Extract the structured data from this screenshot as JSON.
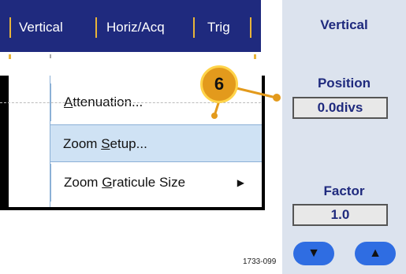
{
  "menubar": {
    "items": [
      {
        "label": "Vertical"
      },
      {
        "label": "Horiz/Acq"
      },
      {
        "label": "Trig"
      }
    ]
  },
  "dropdown": {
    "items": [
      {
        "label_prefix": "",
        "label_underline": "A",
        "label_suffix": "ttenuation..."
      },
      {
        "label_prefix": "Zoom ",
        "label_underline": "S",
        "label_suffix": "etup..."
      },
      {
        "label_prefix": "Zoom ",
        "label_underline": "G",
        "label_suffix": "raticule Size"
      }
    ],
    "submenu_arrow": "▶"
  },
  "callout": {
    "number": "6"
  },
  "panel": {
    "title": "Vertical",
    "position": {
      "label": "Position",
      "value": "0.0divs"
    },
    "factor": {
      "label": "Factor",
      "value": "1.0"
    },
    "down_arrow": "▼",
    "up_arrow": "▲"
  },
  "figure_id": "1733-099",
  "colors": {
    "menubar_bg": "#1f2a7e",
    "separator": "#e8b43a",
    "panel_bg": "#dce3ee",
    "selected_item_bg": "#cfe2f4",
    "callout": "#e39a1c",
    "arrow_button": "#2f6de2"
  }
}
